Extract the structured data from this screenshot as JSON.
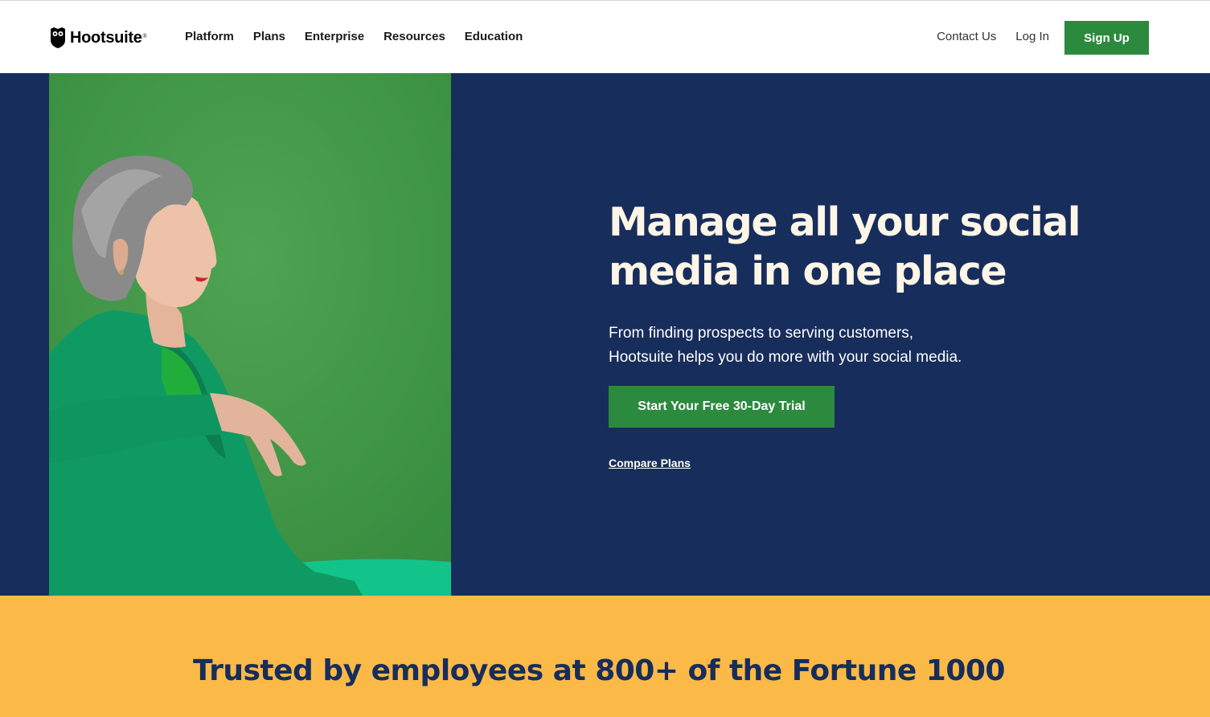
{
  "brand": {
    "name": "Hootsuite",
    "registered_mark": "®"
  },
  "nav": {
    "items": [
      {
        "label": "Platform"
      },
      {
        "label": "Plans"
      },
      {
        "label": "Enterprise"
      },
      {
        "label": "Resources"
      },
      {
        "label": "Education"
      }
    ]
  },
  "header_right": {
    "contact_label": "Contact Us",
    "login_label": "Log In",
    "signup_label": "Sign Up"
  },
  "hero": {
    "title": "Manage all your social media in one place",
    "subtitle_line1": "From finding prospects to serving customers,",
    "subtitle_line2": "Hootsuite helps you do more with your social media.",
    "cta_label": "Start Your Free 30-Day Trial",
    "compare_label": "Compare Plans"
  },
  "trust": {
    "title": "Trusted by employees at 800+ of the Fortune 1000"
  },
  "colors": {
    "brand_green": "#2c8a3e",
    "hero_navy": "#172d5b",
    "photo_green": "#3f9848",
    "trust_yellow": "#fbb947",
    "hero_title_cream": "#fdf5e6"
  }
}
